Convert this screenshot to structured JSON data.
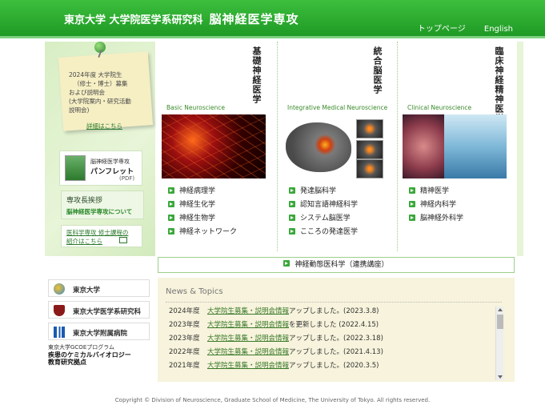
{
  "header": {
    "university": "東京大学 大学院医学系研究科",
    "department": "脳神経医学専攻",
    "nav": [
      "トップページ",
      "English"
    ]
  },
  "memo": {
    "text": [
      "2024年度 大学院生",
      "（修士・博士）募集",
      "および説明会",
      "(大学院案内・研究活動",
      "説明会)"
    ],
    "link": "詳細はこちら"
  },
  "pamphlet": {
    "line1": "脳神経医学専攻",
    "line2": "パンフレット",
    "line3": "(PDF)"
  },
  "greeting": {
    "title": "専攻長挨拶",
    "link": "脳神経医学専攻について"
  },
  "intro": {
    "line1": "医科学専攻 修士課程の",
    "line2": "紹介はこちら"
  },
  "columns": [
    {
      "title": "基礎神経医学",
      "en": "Basic Neuroscience",
      "items": [
        "神経病理学",
        "神経生化学",
        "神経生物学",
        "神経ネットワーク"
      ]
    },
    {
      "title": "統合脳医学",
      "en": "Integrative Medical Neuroscience",
      "items": [
        "発達脳科学",
        "認知言語神経科学",
        "システム脳医学",
        "こころの発達医学"
      ]
    },
    {
      "title": "臨床神経精神医学",
      "en": "Clinical Neuroscience",
      "items": [
        "精神医学",
        "神経内科学",
        "脳神経外科学"
      ]
    }
  ],
  "collab": "神経動態医科学（連携講座）",
  "side_links": [
    "東京大学",
    "東京大学医学系研究科",
    "東京大学附属病院"
  ],
  "gcoe": {
    "line1": "東京大学GCOEプログラム",
    "line2": "疾患のケミカルバイオロジー",
    "line3": "教育研究拠点"
  },
  "news": {
    "title": "News & Topics",
    "items": [
      {
        "year": "2024年度",
        "link": "大学院生募集・説明会情報",
        "rest": "アップしました。(2023.3.8)"
      },
      {
        "year": "2023年度",
        "link": "大学院生募集・説明会情報",
        "rest": "を更新しました (2022.4.15)"
      },
      {
        "year": "2023年度",
        "link": "大学院生募集・説明会情報",
        "rest": "アップしました。(2022.3.18)"
      },
      {
        "year": "2022年度",
        "link": "大学院生募集・説明会情報",
        "rest": "アップしました。(2021.4.13)"
      },
      {
        "year": "2021年度",
        "link": "大学院生募集・説明会情報",
        "rest": "アップしました。(2020.3.5)"
      }
    ]
  },
  "footer": "Copyright © Division of Neuroscience, Graduate School of Medicine, The University of Tokyo. All rights reserved."
}
